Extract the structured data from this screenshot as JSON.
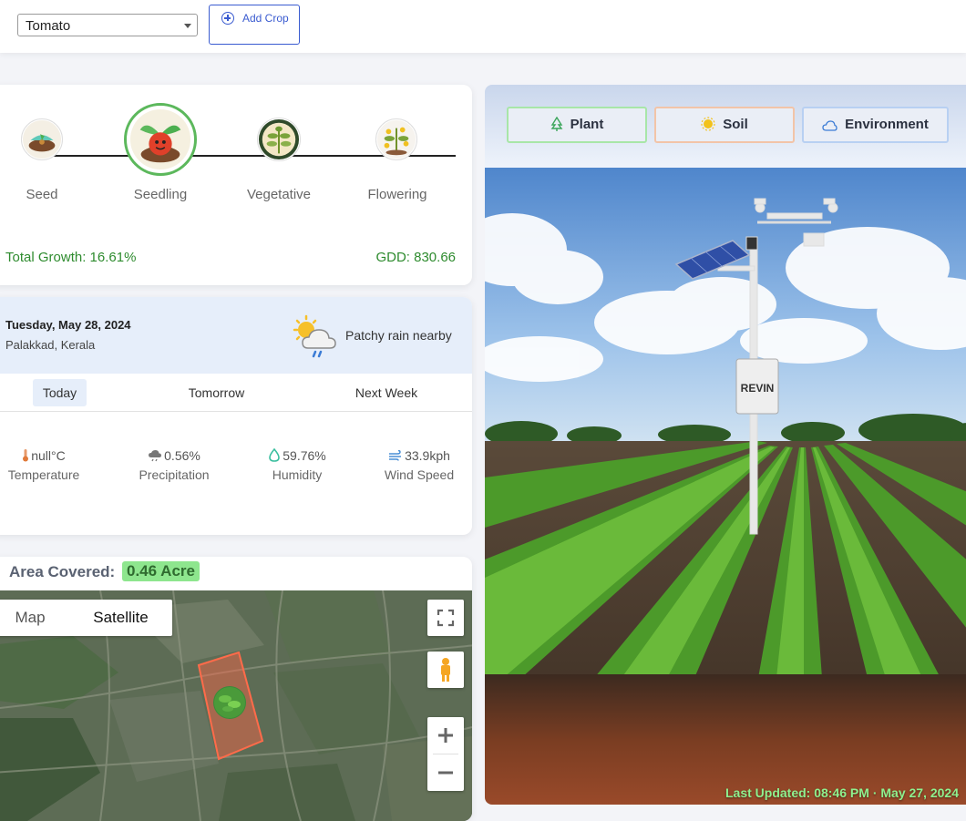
{
  "header": {
    "crop_select": "Tomato",
    "add_crop_label": "Add Crop"
  },
  "growth": {
    "stages": [
      {
        "label": "Seed"
      },
      {
        "label": "Seedling"
      },
      {
        "label": "Vegetative"
      },
      {
        "label": "Flowering"
      }
    ],
    "current_stage": "Seedling",
    "total_growth": "Total Growth: 16.61%",
    "gdd": "GDD: 830.66"
  },
  "weather": {
    "date": "Tuesday, May 28, 2024",
    "location": "Palakkad, Kerala",
    "condition": "Patchy rain nearby",
    "tabs": [
      "Today",
      "Tomorrow",
      "Next Week"
    ],
    "active_tab": "Today",
    "metrics": {
      "temperature": {
        "value": "null°C",
        "label": "Temperature"
      },
      "precipitation": {
        "value": "0.56%",
        "label": "Precipitation"
      },
      "humidity": {
        "value": "59.76%",
        "label": "Humidity"
      },
      "wind": {
        "value": "33.9kph",
        "label": "Wind Speed"
      }
    }
  },
  "area": {
    "label": "Area Covered:",
    "value": "0.46 Acre",
    "map_types": [
      "Map",
      "Satellite"
    ],
    "active_map_type": "Satellite"
  },
  "monitor": {
    "tabs": [
      "Plant",
      "Soil",
      "Environment"
    ],
    "station_label": "REVIN",
    "last_updated": "Last Updated: 08:46 PM · May 27, 2024"
  },
  "colors": {
    "growth_text": "#2e8b2e",
    "tab_plant_border": "#a8e6a8",
    "tab_soil_border": "#f2c4a8",
    "tab_env_border": "#b8d0f2",
    "area_badge_bg": "#8ee68e",
    "last_updated_text": "#8ef08e"
  }
}
